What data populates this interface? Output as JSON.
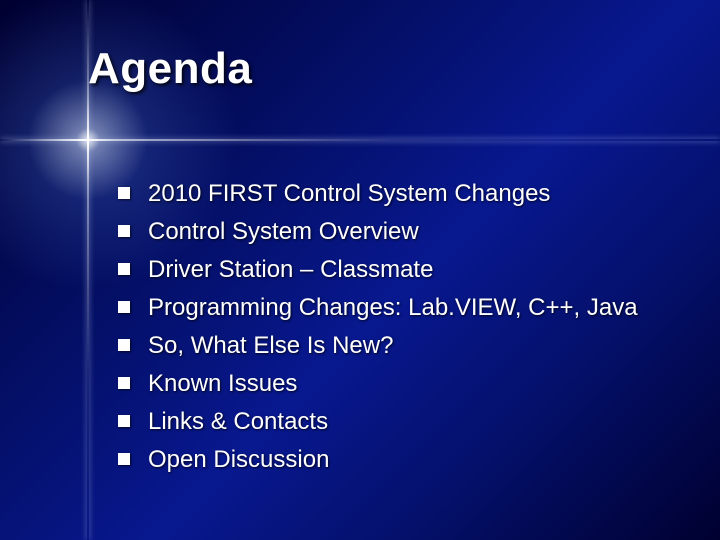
{
  "slide": {
    "title": "Agenda",
    "items": [
      "2010 FIRST Control System Changes",
      "Control System Overview",
      "Driver Station – Classmate",
      "Programming Changes: Lab.VIEW, C++, Java",
      "So, What Else Is New?",
      "Known Issues",
      "Links & Contacts",
      "Open Discussion"
    ]
  }
}
